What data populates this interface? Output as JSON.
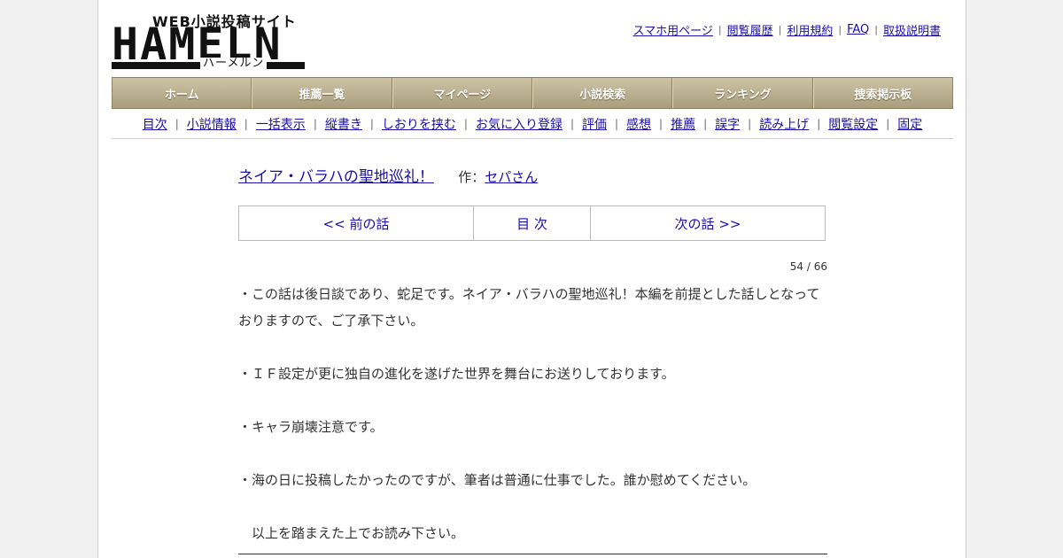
{
  "logo": {
    "tagline": "WEB小説投稿サイト",
    "main": "HAMELN",
    "kana": "ハーメルン"
  },
  "top_links": [
    {
      "label": "スマホ用ページ"
    },
    {
      "label": "閲覧履歴"
    },
    {
      "label": "利用規約"
    },
    {
      "label": "FAQ"
    },
    {
      "label": "取扱説明書"
    }
  ],
  "main_nav": [
    {
      "label": "ホーム"
    },
    {
      "label": "推薦一覧"
    },
    {
      "label": "マイページ"
    },
    {
      "label": "小説検索"
    },
    {
      "label": "ランキング"
    },
    {
      "label": "捜索掲示板"
    }
  ],
  "sub_nav": [
    {
      "label": "目次"
    },
    {
      "label": "小説情報"
    },
    {
      "label": "一括表示"
    },
    {
      "label": "縦書き"
    },
    {
      "label": "しおりを挟む"
    },
    {
      "label": "お気に入り登録"
    },
    {
      "label": "評価"
    },
    {
      "label": "感想"
    },
    {
      "label": "推薦"
    },
    {
      "label": "誤字"
    },
    {
      "label": "読み上げ"
    },
    {
      "label": "閲覧設定"
    },
    {
      "label": "固定"
    }
  ],
  "novel": {
    "title": "ネイア・バラハの聖地巡礼！",
    "author_label": "作：",
    "author": "セパさん"
  },
  "chapter_nav": {
    "prev": "<< 前の話",
    "toc": "目 次",
    "next": "次の話 >>"
  },
  "page_count": "54 / 66",
  "content": {
    "p1": "・この話は後日談であり、蛇足です。ネイア・バラハの聖地巡礼！本編を前提とした話しとなっておりますので、ご了承下さい。",
    "p2": "・ＩＦ設定が更に独自の進化を遂げた世界を舞台にお送りしております。",
    "p3": "・キャラ崩壊注意です。",
    "p4": "・海の日に投稿したかったのですが、筆者は普通に仕事でした。誰か慰めてください。",
    "p5": "　以上を踏まえた上でお読み下さい。"
  }
}
